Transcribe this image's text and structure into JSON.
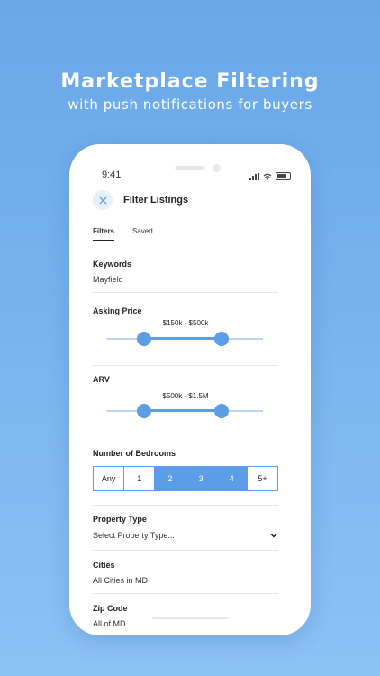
{
  "promo": {
    "headline": "Marketplace Filtering",
    "subline": "with push notifications for buyers"
  },
  "status": {
    "time": "9:41"
  },
  "header": {
    "close_icon": "close-icon",
    "title": "Filter Listings"
  },
  "tabs": [
    {
      "label": "Filters",
      "active": true
    },
    {
      "label": "Saved",
      "active": false
    }
  ],
  "keywords": {
    "label": "Keywords",
    "value": "Mayfield"
  },
  "asking_price": {
    "label": "Asking Price",
    "range": "$150k - $500k"
  },
  "arv": {
    "label": "ARV",
    "range": "$500k - $1.5M"
  },
  "bedrooms": {
    "label": "Number of Bedrooms",
    "options": [
      "Any",
      "1",
      "2",
      "3",
      "4",
      "5+"
    ],
    "selected": [
      "2",
      "3",
      "4"
    ]
  },
  "property_type": {
    "label": "Property Type",
    "placeholder": "Select Property Type..."
  },
  "cities": {
    "label": "Cities",
    "value": "All Cities in MD"
  },
  "zip_code": {
    "label": "Zip Code",
    "value": "All of MD"
  },
  "colors": {
    "accent": "#5b9de6",
    "background_top": "#69a7e9",
    "background_bottom": "#8dc2f4"
  }
}
